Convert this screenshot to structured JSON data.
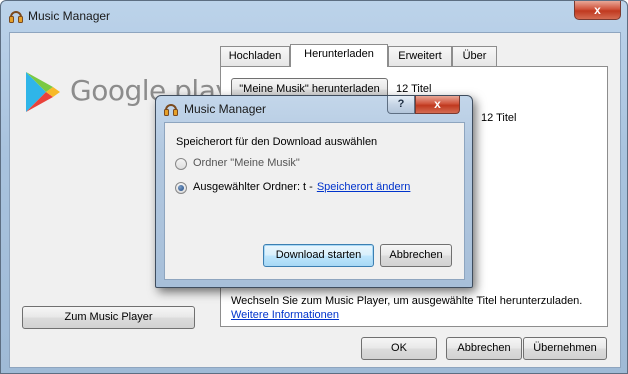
{
  "main_window": {
    "title": "Music Manager",
    "close_label": "x"
  },
  "logo": {
    "text": "Google play"
  },
  "sidebar": {
    "music_player_button": "Zum Music Player"
  },
  "tabs": [
    {
      "label": "Hochladen"
    },
    {
      "label": "Herunterladen"
    },
    {
      "label": "Erweitert"
    },
    {
      "label": "Über"
    }
  ],
  "active_tab": "Herunterladen",
  "panel": {
    "download_button": "\"Meine Musik\" herunterladen",
    "count_1": "12 Titel",
    "count_2": "12 Titel",
    "info_text": "Wechseln Sie zum Music Player, um ausgewählte Titel herunterzuladen.",
    "info_link": "Weitere Informationen"
  },
  "footer": {
    "ok": "OK",
    "cancel": "Abbrechen",
    "apply": "Übernehmen"
  },
  "dialog": {
    "title": "Music Manager",
    "help_label": "?",
    "close_label": "x",
    "prompt": "Speicherort für den Download auswählen",
    "option_1": "Ordner \"Meine Musik\"",
    "option_2": "Ausgewählter Ordner: t -",
    "option_2_link": "Speicherort ändern",
    "selected_option": "option_2",
    "start_button": "Download starten",
    "cancel_button": "Abbrechen"
  },
  "colors": {
    "title_bar": "#b4cbe4",
    "close_button": "#c7432a",
    "link": "#0033cc"
  }
}
